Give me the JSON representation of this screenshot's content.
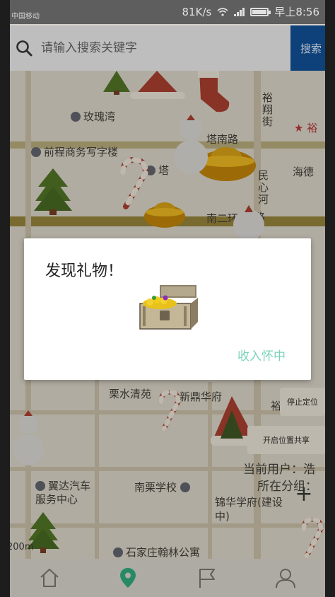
{
  "status_bar": {
    "carrier": "中国移动",
    "network_speed": "81K/s",
    "time": "早上8:56",
    "battery_level": 0.9
  },
  "search": {
    "placeholder": "请输入搜索关键字",
    "button_label": "搜索"
  },
  "map": {
    "labels": {
      "rose_bay": "玫瑰湾",
      "qiancheng_office": "前程商务写字楼",
      "tanan_road": "塔南路",
      "ta": "塔",
      "yuxiang_street": "裕翔街",
      "yu_top": "裕",
      "minxin_river": "民心河",
      "nanerhuan": "南二环",
      "lu": "路",
      "haide": "海德",
      "lishui": "栗水清苑",
      "xinding": "新鼎华府",
      "yida": "翼达汽车服务中心",
      "nanli_school": "南栗学校",
      "jinhua_school": "锦华学府(建设中)",
      "hanlin": "石家庄翰林公寓",
      "yu_bottom": "裕"
    },
    "stop_location_button": "停止定位",
    "start_share_button": "开启位置共享",
    "current_user_label": "当前用户：浩",
    "group_label": "所在分组：",
    "zoom_in": "+",
    "scale": "200m"
  },
  "dialog": {
    "title": "发现礼物！",
    "action_label": "收入怀中",
    "icon": "treasure-chest-icon"
  },
  "bottom_nav": {
    "items": [
      {
        "icon": "home-icon",
        "active": false
      },
      {
        "icon": "location-pin-icon",
        "active": true
      },
      {
        "icon": "flag-icon",
        "active": false
      },
      {
        "icon": "user-icon",
        "active": false
      }
    ],
    "active_color": "#2e9e74"
  }
}
